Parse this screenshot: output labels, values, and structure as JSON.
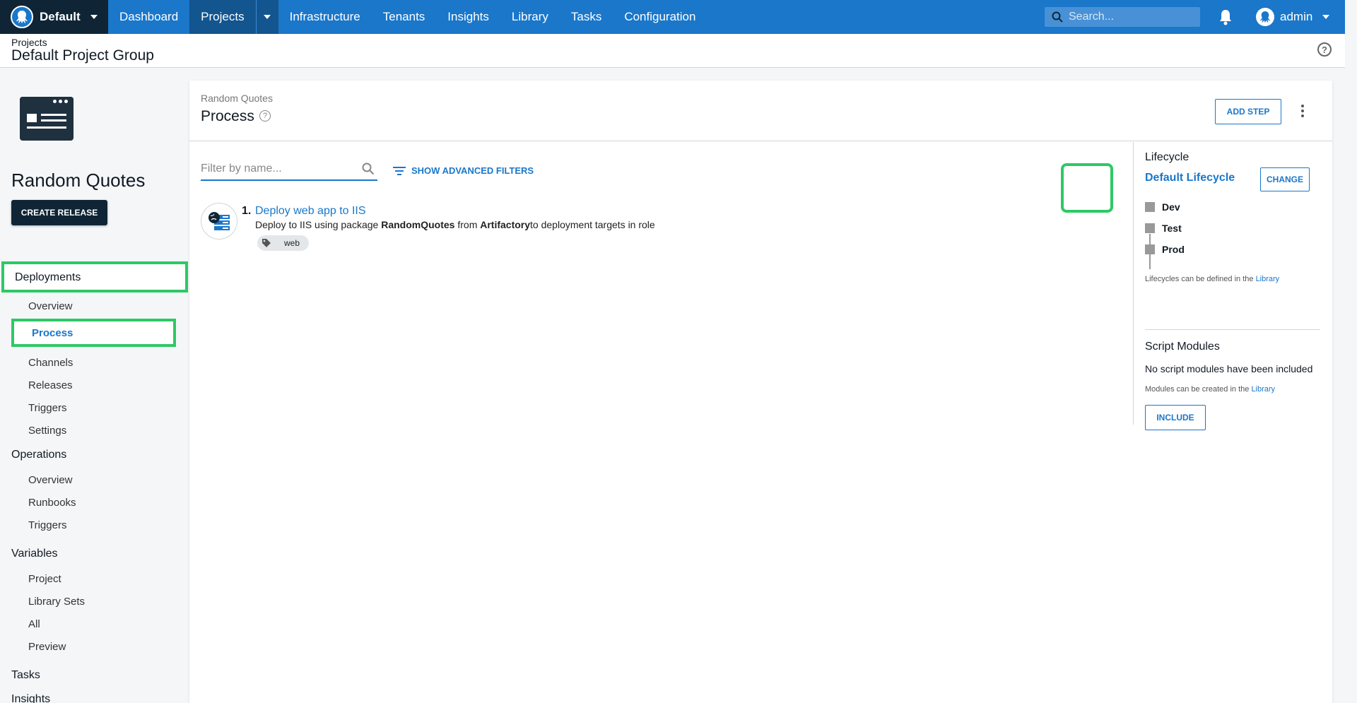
{
  "topnav": {
    "space": "Default",
    "items": [
      "Dashboard",
      "Projects",
      "Infrastructure",
      "Tenants",
      "Insights",
      "Library",
      "Tasks",
      "Configuration"
    ],
    "active": "Projects",
    "search_placeholder": "Search...",
    "user": "admin"
  },
  "header": {
    "breadcrumb": "Projects",
    "title": "Default Project Group"
  },
  "sidebar": {
    "project_name": "Random Quotes",
    "create_release": "CREATE RELEASE",
    "deployments": {
      "label": "Deployments",
      "items": [
        "Overview",
        "Process",
        "Channels",
        "Releases",
        "Triggers",
        "Settings"
      ]
    },
    "operations": {
      "label": "Operations",
      "items": [
        "Overview",
        "Runbooks",
        "Triggers"
      ]
    },
    "variables": {
      "label": "Variables",
      "items": [
        "Project",
        "Library Sets",
        "All",
        "Preview"
      ]
    },
    "tasks": "Tasks",
    "insights": "Insights"
  },
  "main": {
    "breadcrumb": "Random Quotes",
    "title": "Process",
    "add_step": "ADD STEP",
    "filter_placeholder": "Filter by name...",
    "advanced_filters": "SHOW ADVANCED FILTERS",
    "steps": [
      {
        "number": "1.",
        "name": "Deploy web app to IIS",
        "desc_prefix": "Deploy to IIS using package",
        "package": "RandomQuotes",
        "desc_from": "from",
        "feed": "Artifactory",
        "desc_suffix": "to deployment targets in role",
        "role": "web"
      }
    ]
  },
  "panel": {
    "lifecycle_heading": "Lifecycle",
    "lifecycle_name": "Default Lifecycle",
    "change": "CHANGE",
    "phases": [
      "Dev",
      "Test",
      "Prod"
    ],
    "lifecycle_note": "Lifecycles can be defined in the",
    "library_link": "Library",
    "script_heading": "Script Modules",
    "script_none": "No script modules have been included",
    "modules_note": "Modules can be created in the",
    "include": "INCLUDE"
  },
  "colors": {
    "brand": "#1a77ca",
    "nav_dark": "#0f2535",
    "highlight": "#2ec866"
  }
}
